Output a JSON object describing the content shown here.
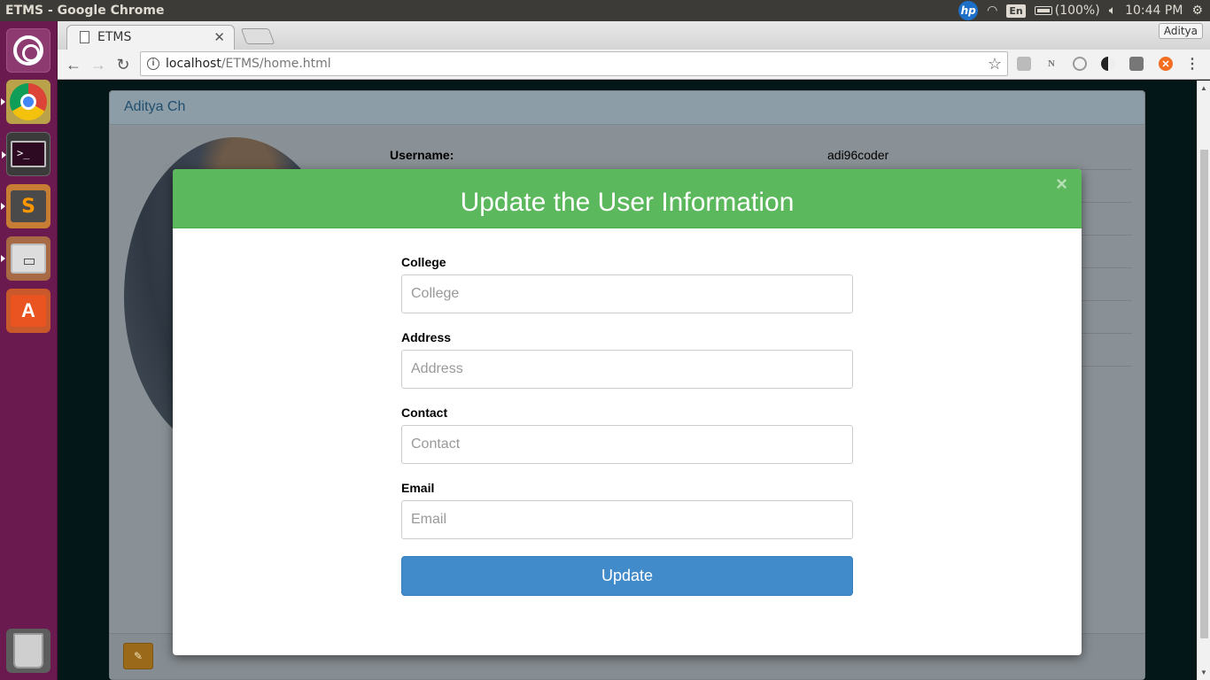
{
  "window_title": "ETMS - Google Chrome",
  "system_tray": {
    "language": "En",
    "battery": "(100%)",
    "clock": "10:44 PM",
    "hp_label": "hp"
  },
  "browser": {
    "tab_title": "ETMS",
    "profile_name": "Aditya",
    "url_host": "localhost",
    "url_path": "/ETMS/home.html"
  },
  "panel": {
    "heading": "Aditya Ch",
    "rows": [
      {
        "key": "Username:",
        "value": "adi96coder"
      }
    ]
  },
  "modal": {
    "title": "Update the User Information",
    "close_symbol": "×",
    "fields": [
      {
        "label": "College",
        "placeholder": "College"
      },
      {
        "label": "Address",
        "placeholder": "Address"
      },
      {
        "label": "Contact",
        "placeholder": "Contact"
      },
      {
        "label": "Email",
        "placeholder": "Email"
      }
    ],
    "submit_label": "Update"
  },
  "colors": {
    "modal_header": "#5cb85c",
    "update_button": "#428bca",
    "launcher": "#6b1a4f"
  }
}
